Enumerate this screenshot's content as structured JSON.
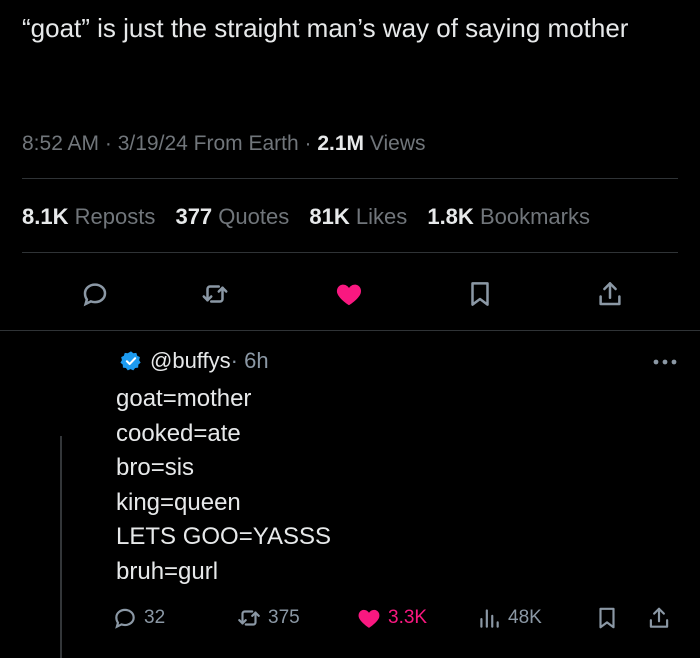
{
  "tweet": {
    "text": "“goat” is just the straight man’s way of saying mother",
    "time": "8:52 AM",
    "date": "3/19/24",
    "source": "From Earth",
    "views_count": "2.1M",
    "views_label": "Views"
  },
  "stats": [
    {
      "num": "8.1K",
      "label": "Reposts"
    },
    {
      "num": "377",
      "label": "Quotes"
    },
    {
      "num": "81K",
      "label": "Likes"
    },
    {
      "num": "1.8K",
      "label": "Bookmarks"
    }
  ],
  "actions": {
    "icons": [
      "reply-icon",
      "repost-icon",
      "like-icon-filled",
      "bookmark-icon",
      "share-icon"
    ],
    "like_color": "#f91880"
  },
  "reply": {
    "handle": "@buffys",
    "time": "· 6h",
    "lines": [
      "goat=mother",
      "cooked=ate",
      "bro=sis",
      "king=queen",
      "LETS GOO=YASSS",
      "bruh=gurl"
    ],
    "replies": "32",
    "reposts": "375",
    "likes": "3.3K",
    "views": "48K",
    "verified_color": "#1d9bf0"
  },
  "colors": {
    "background": "#000000",
    "text": "#e7e9ea",
    "muted": "#71767b",
    "accent_like": "#f91880",
    "verified": "#1d9bf0"
  }
}
